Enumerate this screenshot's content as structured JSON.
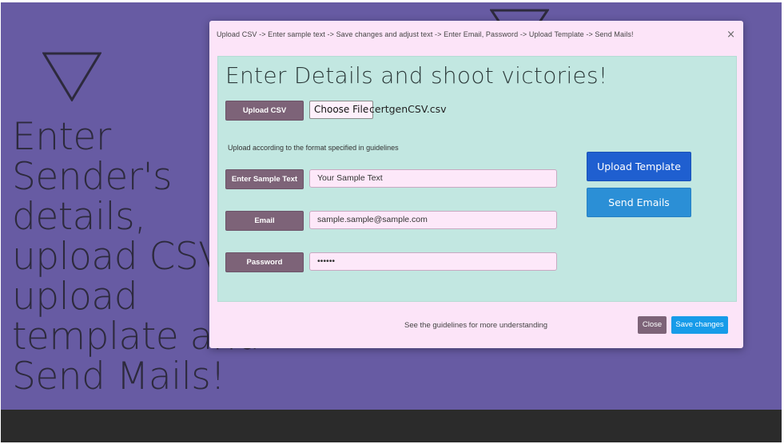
{
  "hero": {
    "text": "Enter Sender's details, upload CSV , upload template and Send Mails!"
  },
  "modal": {
    "steps": "Upload CSV -> Enter sample text -> Save changes and adjust text -> Enter Email, Password -> Upload Template -> Send Mails!",
    "close_symbol": "×",
    "title": "Enter Details and shoot victories!",
    "upload_csv_label": "Upload CSV",
    "choose_file_label": "Choose File",
    "file_name": "certgenCSV.csv",
    "upload_hint": "Upload according to the format specified in guidelines",
    "sample_text_label": "Enter Sample Text",
    "sample_text_value": "Your Sample Text",
    "email_label": "Email",
    "email_value": "sample.sample@sample.com",
    "password_label": "Password",
    "password_value": "••••••",
    "upload_template_button": "Upload Template",
    "send_emails_button": "Send Emails",
    "footer_text": "See the guidelines for more understanding",
    "close_button": "Close",
    "save_button": "Save changes"
  },
  "colors": {
    "background": "#675ba3",
    "modal": "#fce4f8",
    "panel": "#c2e7e1",
    "label_button": "#7d6378",
    "primary": "#1f5fd0",
    "info": "#2b8fd6"
  }
}
